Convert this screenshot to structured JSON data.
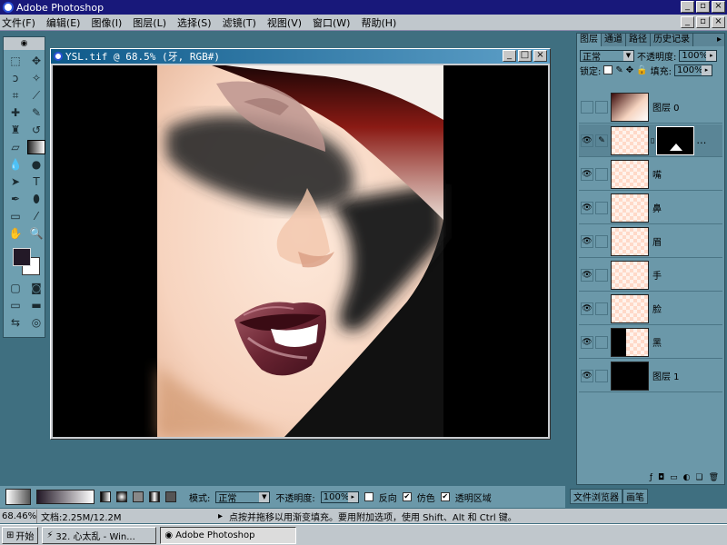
{
  "app": {
    "title": "Adobe Photoshop"
  },
  "menu": [
    "文件(F)",
    "编辑(E)",
    "图像(I)",
    "图层(L)",
    "选择(S)",
    "滤镜(T)",
    "视图(V)",
    "窗口(W)",
    "帮助(H)"
  ],
  "document": {
    "title": "YSL.tif @ 68.5% (牙, RGB#)"
  },
  "colors": {
    "foreground": "#231927",
    "background": "#ffffff",
    "accent": "#6b98a9"
  },
  "layers_panel": {
    "tabs": [
      "图层",
      "通道",
      "路径",
      "历史记录"
    ],
    "blend_mode": "正常",
    "opacity_label": "不透明度:",
    "opacity_value": "100%",
    "lock_label": "锁定:",
    "fill_label": "填充:",
    "fill_value": "100%",
    "layers": [
      {
        "name": "图层 0",
        "visible": false
      },
      {
        "name": "",
        "visible": true,
        "masked": true
      },
      {
        "name": "嘴",
        "visible": true
      },
      {
        "name": "鼻",
        "visible": true
      },
      {
        "name": "眉",
        "visible": true
      },
      {
        "name": "手",
        "visible": true
      },
      {
        "name": "脸",
        "visible": true
      },
      {
        "name": "黑",
        "visible": true
      },
      {
        "name": "图层 1",
        "visible": true
      }
    ],
    "bottom_tabs": [
      "文件浏览器",
      "画笔"
    ]
  },
  "options": {
    "mode_label": "模式:",
    "mode_value": "正常",
    "opacity_label": "不透明度:",
    "opacity_value": "100%",
    "reverse_label": "反向",
    "dither_label": "仿色",
    "transparency_label": "透明区域"
  },
  "status": {
    "zoom": "68.46%",
    "doc_info": "文档:2.25M/12.2M",
    "hint": "点按并拖移以用渐变填充。要用附加选项，使用 Shift、Alt 和 Ctrl 键。"
  },
  "taskbar": {
    "start": "开始",
    "items": [
      "32. 心太乱 - Win...",
      "Adobe Photoshop"
    ]
  }
}
